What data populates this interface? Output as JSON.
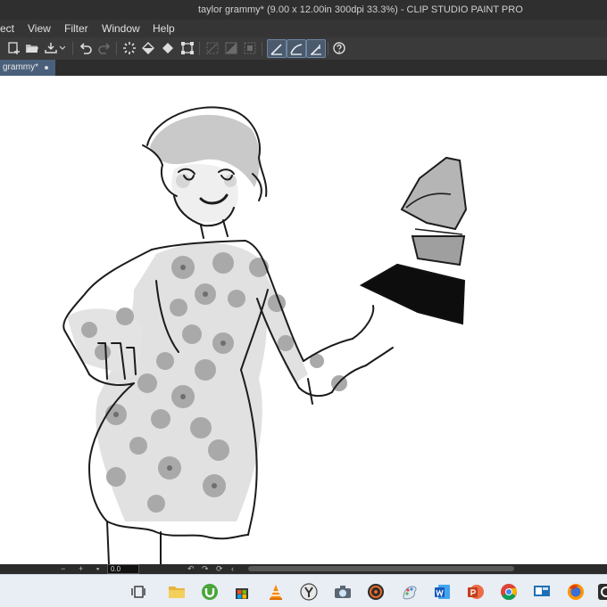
{
  "window": {
    "title": "taylor grammy* (9.00 x 12.00in 300dpi 33.3%)  - CLIP STUDIO PAINT PRO"
  },
  "menu": {
    "items": [
      "ect",
      "View",
      "Filter",
      "Window",
      "Help"
    ]
  },
  "tab": {
    "label": "grammy*"
  },
  "status": {
    "zoom": "0.0"
  },
  "colors": {
    "titlebar": "#2f2f2f",
    "menubar": "#353535",
    "toolbar": "#3a3a3a",
    "tab_active": "#4a607a",
    "taskbar": "#e9edf4"
  },
  "toolbar_icons": [
    "new-canvas-icon",
    "open-folder-icon",
    "save-icon",
    "undo-icon",
    "redo-icon",
    "loading-icon",
    "fill-icon",
    "transform-icon",
    "snap-to-ruler-icon",
    "snap-to-special-ruler-icon",
    "snap-to-grid-icon",
    "stroke-correction-icon",
    "curve-correction-icon",
    "line-correction-icon",
    "help-icon"
  ],
  "taskbar_icons": [
    "task-view-icon",
    "file-explorer-icon",
    "utorrent-icon",
    "store-icon",
    "vlc-icon",
    "yandex-icon",
    "camera-icon",
    "media-player-icon",
    "paint-icon",
    "word-icon",
    "powerpoint-icon",
    "chrome-icon",
    "remote-desktop-icon",
    "firefox-icon",
    "clip-studio-icon"
  ]
}
